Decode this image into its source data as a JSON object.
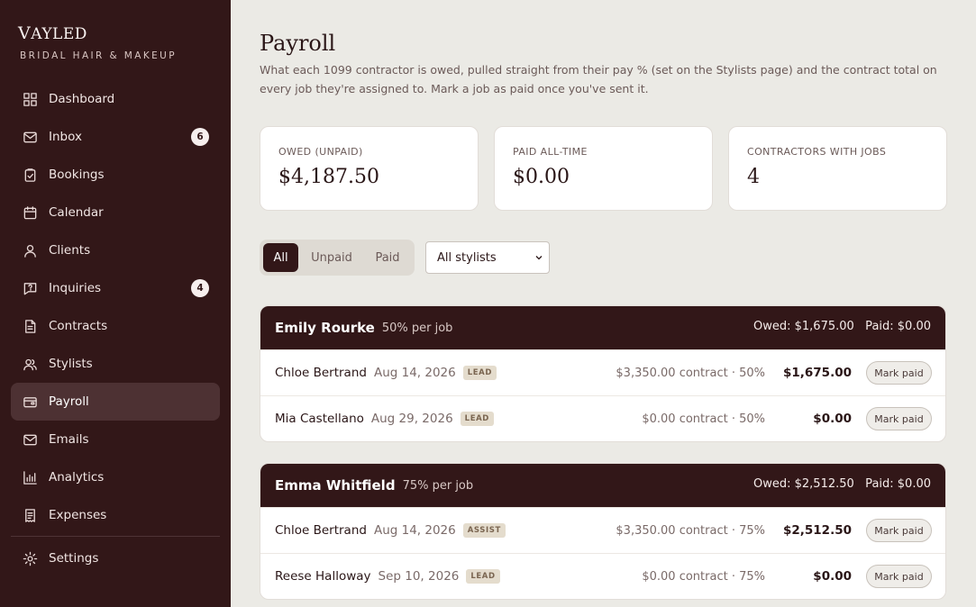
{
  "brand": {
    "first": "V",
    "rest": "AYLED",
    "tagline": "BRIDAL HAIR & MAKEUP"
  },
  "sidebar": {
    "items": [
      {
        "label": "Dashboard",
        "icon": "grid-icon"
      },
      {
        "label": "Inbox",
        "icon": "mail-icon",
        "badge": "6"
      },
      {
        "label": "Bookings",
        "icon": "clipboard-check-icon"
      },
      {
        "label": "Calendar",
        "icon": "calendar-icon"
      },
      {
        "label": "Clients",
        "icon": "user-icon"
      },
      {
        "label": "Inquiries",
        "icon": "message-question-icon",
        "badge": "4"
      },
      {
        "label": "Contracts",
        "icon": "document-icon"
      },
      {
        "label": "Stylists",
        "icon": "users-icon"
      },
      {
        "label": "Payroll",
        "icon": "wallet-icon",
        "active": true
      },
      {
        "label": "Emails",
        "icon": "envelope-icon"
      },
      {
        "label": "Analytics",
        "icon": "bar-chart-icon"
      },
      {
        "label": "Expenses",
        "icon": "receipt-icon"
      }
    ],
    "settings": {
      "label": "Settings",
      "icon": "gear-icon"
    }
  },
  "page": {
    "title": "Payroll",
    "description": "What each 1099 contractor is owed, pulled straight from their pay % (set on the Stylists page) and the contract total on every job they're assigned to. Mark a job as paid once you've sent it."
  },
  "stats": [
    {
      "label": "OWED (UNPAID)",
      "value": "$4,187.50"
    },
    {
      "label": "PAID ALL-TIME",
      "value": "$0.00"
    },
    {
      "label": "CONTRACTORS WITH JOBS",
      "value": "4"
    }
  ],
  "filters": {
    "tabs": [
      "All",
      "Unpaid",
      "Paid"
    ],
    "active_tab": "All",
    "stylist_select": "All stylists"
  },
  "groups": [
    {
      "name": "Emily Rourke",
      "rate": "50% per job",
      "totals": "Owed: $1,675.00   Paid: $0.00",
      "rows": [
        {
          "client": "Chloe Bertrand",
          "date": "Aug 14, 2026",
          "role": "LEAD",
          "contract": "$3,350.00 contract · 50%",
          "amount": "$1,675.00",
          "action": "Mark paid"
        },
        {
          "client": "Mia Castellano",
          "date": "Aug 29, 2026",
          "role": "LEAD",
          "contract": "$0.00 contract · 50%",
          "amount": "$0.00",
          "action": "Mark paid"
        }
      ]
    },
    {
      "name": "Emma Whitfield",
      "rate": "75% per job",
      "totals": "Owed: $2,512.50   Paid: $0.00",
      "rows": [
        {
          "client": "Chloe Bertrand",
          "date": "Aug 14, 2026",
          "role": "ASSIST",
          "contract": "$3,350.00 contract · 75%",
          "amount": "$2,512.50",
          "action": "Mark paid"
        },
        {
          "client": "Reese Halloway",
          "date": "Sep 10, 2026",
          "role": "LEAD",
          "contract": "$0.00 contract · 75%",
          "amount": "$0.00",
          "action": "Mark paid"
        }
      ]
    }
  ],
  "colors": {
    "sidebar": "#321718",
    "accent": "#321718",
    "background": "#ebeae5",
    "badge_role": "#e4dccd"
  }
}
